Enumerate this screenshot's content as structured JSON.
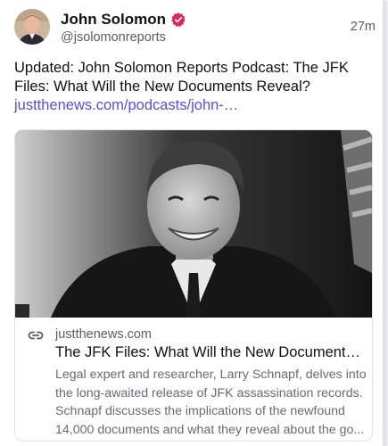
{
  "author": {
    "display_name": "John Solomon",
    "handle": "@jsolomonreports",
    "verified_color": "#e0245e",
    "avatar_icon": "person-avatar"
  },
  "post": {
    "timestamp": "27m",
    "text_lines": [
      "Updated: John Solomon Reports Podcast: The JFK",
      "Files: What Will the New Documents Reveal?"
    ],
    "link_text": "justthenews.com/podcasts/john-…",
    "link_color": "#5b4ce0"
  },
  "card": {
    "image_icon": "portrait-photo",
    "domain_icon": "link-icon",
    "domain": "justthenews.com",
    "title": "The JFK Files: What Will the New Documents R...",
    "description_lines": [
      "Legal expert and researcher, Larry Schnapf, delves into",
      "the long-awaited release of JFK assassination records.",
      "Schnapf discusses the implications of the newfound",
      "14,000 documents and what they reveal about the go..."
    ]
  }
}
